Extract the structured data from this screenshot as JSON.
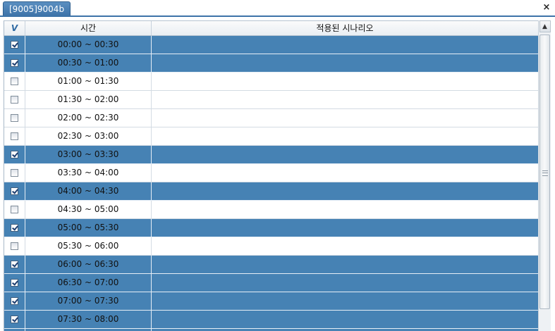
{
  "window": {
    "tab_title": "[9005]9004b",
    "close_icon": "×"
  },
  "table": {
    "headers": {
      "check": "V",
      "time": "시간",
      "scenario": "적용된 시나리오"
    },
    "rows": [
      {
        "time": "00:00 ~ 00:30",
        "checked": true,
        "scenario": ""
      },
      {
        "time": "00:30 ~ 01:00",
        "checked": true,
        "scenario": ""
      },
      {
        "time": "01:00 ~ 01:30",
        "checked": false,
        "scenario": ""
      },
      {
        "time": "01:30 ~ 02:00",
        "checked": false,
        "scenario": ""
      },
      {
        "time": "02:00 ~ 02:30",
        "checked": false,
        "scenario": ""
      },
      {
        "time": "02:30 ~ 03:00",
        "checked": false,
        "scenario": ""
      },
      {
        "time": "03:00 ~ 03:30",
        "checked": true,
        "scenario": ""
      },
      {
        "time": "03:30 ~ 04:00",
        "checked": false,
        "scenario": ""
      },
      {
        "time": "04:00 ~ 04:30",
        "checked": true,
        "scenario": ""
      },
      {
        "time": "04:30 ~ 05:00",
        "checked": false,
        "scenario": ""
      },
      {
        "time": "05:00 ~ 05:30",
        "checked": true,
        "scenario": ""
      },
      {
        "time": "05:30 ~ 06:00",
        "checked": false,
        "scenario": ""
      },
      {
        "time": "06:00 ~ 06:30",
        "checked": true,
        "scenario": ""
      },
      {
        "time": "06:30 ~ 07:00",
        "checked": true,
        "scenario": ""
      },
      {
        "time": "07:00 ~ 07:30",
        "checked": true,
        "scenario": ""
      },
      {
        "time": "07:30 ~ 08:00",
        "checked": true,
        "scenario": ""
      },
      {
        "time": "",
        "checked": true,
        "scenario": ""
      }
    ]
  },
  "colors": {
    "selected_row": "#4682b4",
    "tab": "#3d73a8"
  }
}
